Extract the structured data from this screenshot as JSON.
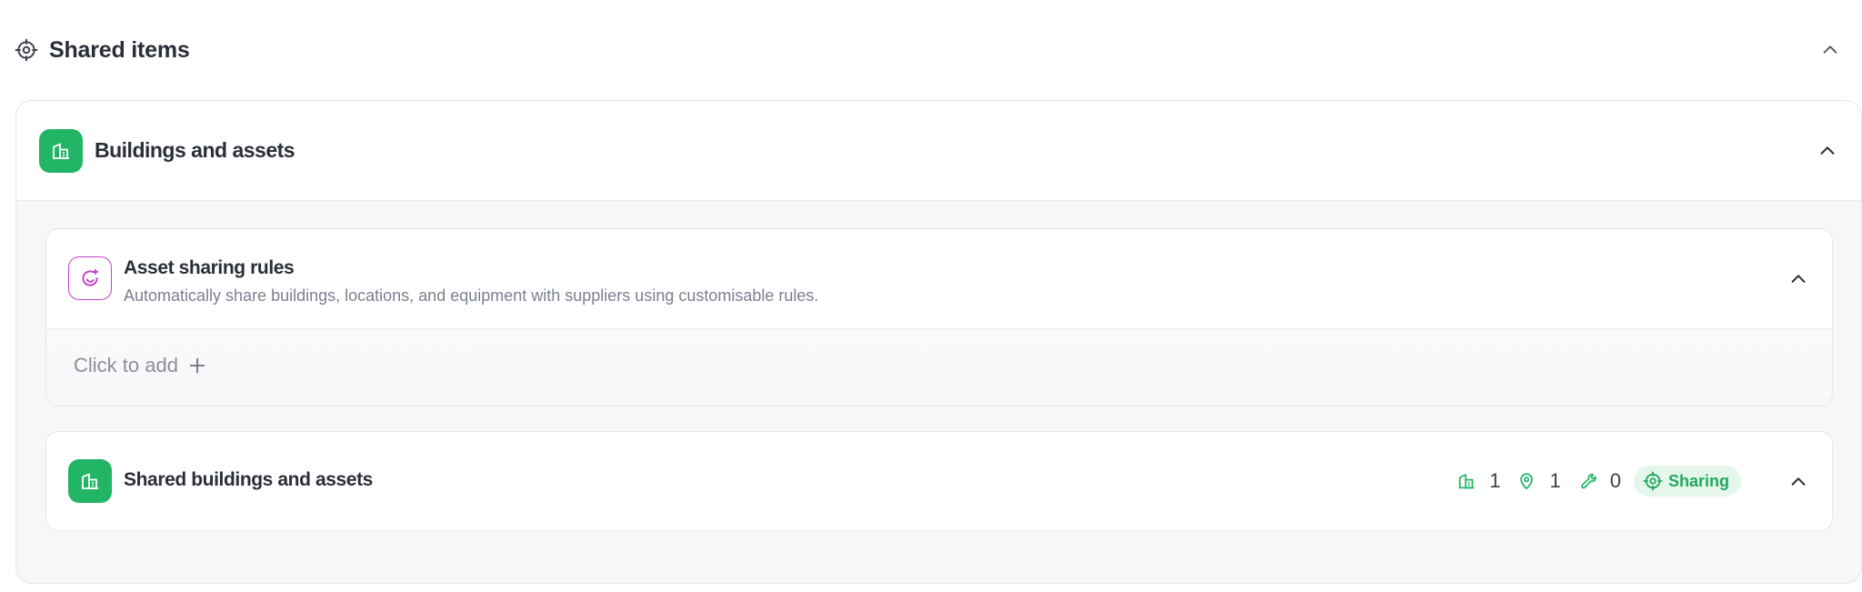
{
  "section": {
    "title": "Shared items",
    "icon": "share-target-icon"
  },
  "buildings_assets": {
    "title": "Buildings and assets",
    "icon": "building-icon",
    "accent": "#22b566"
  },
  "asset_sharing_rules": {
    "title": "Asset sharing rules",
    "subtitle": "Automatically share buildings, locations, and equipment with suppliers using customisable rules.",
    "icon": "sparkle-refresh-icon",
    "accent": "#c243c7",
    "add_label": "Click to add"
  },
  "shared_buildings": {
    "title": "Shared buildings and assets",
    "icon": "building-icon",
    "stats": {
      "buildings": "1",
      "locations": "1",
      "equipment": "0"
    },
    "status": "Sharing",
    "status_color": "#22a85e"
  }
}
